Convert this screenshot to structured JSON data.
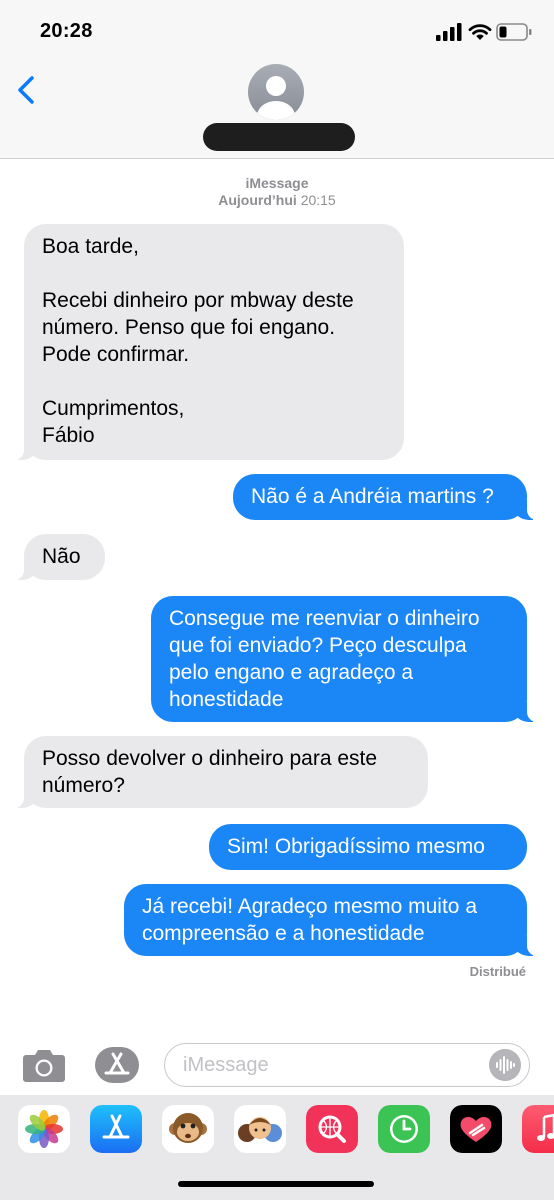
{
  "status_bar": {
    "time": "20:28"
  },
  "header": {
    "back_label": "Back",
    "contact_name": ""
  },
  "conversation": {
    "service": "iMessage",
    "date_label": "Aujourd’hui",
    "time_label": "20:15",
    "messages": [
      {
        "direction": "in",
        "text": "Boa tarde,\n\nRecebi dinheiro por mbway deste\nnúmero. Penso que foi engano.\nPode confirmar.\n\nCumprimentos,\nFábio"
      },
      {
        "direction": "out",
        "text": "Não é a Andréia martins ?"
      },
      {
        "direction": "in",
        "text": "Não"
      },
      {
        "direction": "out",
        "text": "Consegue me reenviar o dinheiro\nque foi enviado? Peço desculpa\npelo engano e agradeço a\nhonestidade"
      },
      {
        "direction": "in",
        "text": "Posso devolver o dinheiro para este\nnúmero?"
      },
      {
        "direction": "out",
        "text": "Sim! Obrigadíssimo mesmo"
      },
      {
        "direction": "out",
        "text": "Já recebi! Agradeço mesmo muito a\ncompreensão e a honestidade"
      }
    ],
    "delivery_status": "Distribué"
  },
  "input_bar": {
    "placeholder": "iMessage"
  },
  "app_drawer": {
    "apps": [
      {
        "name": "photos-app-icon"
      },
      {
        "name": "app-store-app-icon"
      },
      {
        "name": "animoji-app-icon"
      },
      {
        "name": "memoji-stickers-app-icon"
      },
      {
        "name": "image-search-app-icon"
      },
      {
        "name": "clock-app-icon"
      },
      {
        "name": "fitness-heart-app-icon"
      },
      {
        "name": "music-app-icon"
      }
    ]
  },
  "colors": {
    "outgoing_bubble": "#1b86f5",
    "incoming_bubble": "#e9e9eb",
    "ios_blue": "#0a7aff"
  }
}
